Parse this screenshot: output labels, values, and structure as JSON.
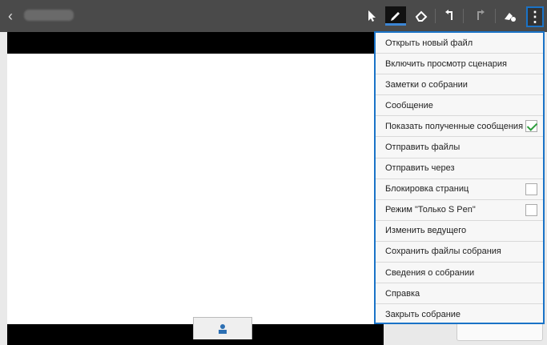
{
  "toolbar": {
    "tools": [
      {
        "icon": "pointer-icon",
        "active": false
      },
      {
        "icon": "pen-icon",
        "active": true
      },
      {
        "icon": "eraser-icon",
        "active": false
      },
      {
        "icon": "undo-icon",
        "active": false
      },
      {
        "icon": "redo-icon",
        "active": false
      },
      {
        "icon": "clear-icon",
        "active": false
      }
    ],
    "more_icon": "more-vertical-icon",
    "accent_color": "#1a73c7"
  },
  "menu": {
    "items": [
      {
        "label": "Открыть новый файл"
      },
      {
        "label": "Включить просмотр сценария"
      },
      {
        "label": "Заметки о собрании"
      },
      {
        "label": "Сообщение"
      },
      {
        "label": "Показать полученные сообщения",
        "checkbox": true,
        "checked": true
      },
      {
        "label": "Отправить файлы"
      },
      {
        "label": "Отправить через"
      },
      {
        "label": "Блокировка страниц",
        "checkbox": true,
        "checked": false
      },
      {
        "label": "Режим \"Только S Pen\"",
        "checkbox": true,
        "checked": false
      },
      {
        "label": "Изменить ведущего"
      },
      {
        "label": "Сохранить файлы собрания"
      },
      {
        "label": "Сведения о собрании"
      },
      {
        "label": "Справка"
      },
      {
        "label": "Закрыть собрание"
      }
    ]
  },
  "bottom_tab": {
    "icon": "participants-icon"
  }
}
